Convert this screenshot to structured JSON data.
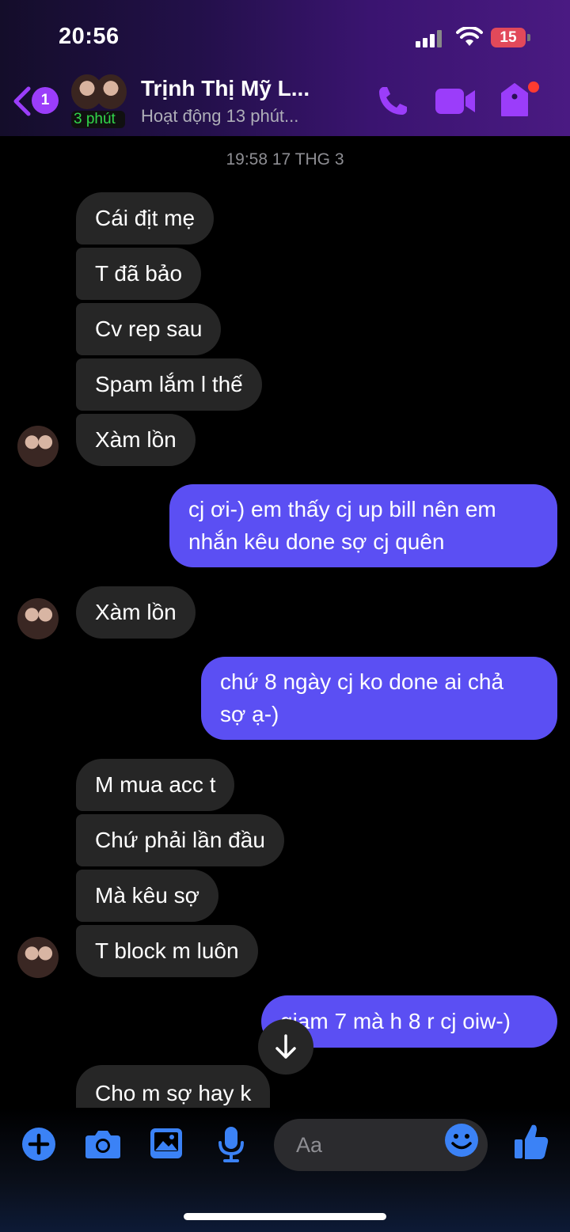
{
  "status_bar": {
    "time": "20:56",
    "battery": "15"
  },
  "header": {
    "back_badge": "1",
    "contact_name": "Trịnh Thị Mỹ L...",
    "active_ago": "3 phút",
    "status": "Hoạt động 13 phút..."
  },
  "timestamp": "19:58 17 THG 3",
  "messages": [
    {
      "from": "them",
      "text": "Cái địt mẹ"
    },
    {
      "from": "them",
      "text": "T đã bảo"
    },
    {
      "from": "them",
      "text": "Cv rep sau"
    },
    {
      "from": "them",
      "text": "Spam lắm l thế"
    },
    {
      "from": "them",
      "text": "Xàm lồn"
    },
    {
      "from": "me",
      "line1": "cj ơi-) em thấy cj up bill nên em",
      "line2": "nhắn kêu done sợ cj quên"
    },
    {
      "from": "them",
      "text": "Xàm lồn"
    },
    {
      "from": "me",
      "line1": "chứ 8 ngày cj ko done ai chả",
      "line2": "sợ ạ-)"
    },
    {
      "from": "them",
      "text": "M mua acc t"
    },
    {
      "from": "them",
      "text": "Chứ phải lần đầu"
    },
    {
      "from": "them",
      "text": "Mà kêu sợ"
    },
    {
      "from": "them",
      "text": "T block m luôn"
    },
    {
      "from": "me",
      "text": "giam 7 mà h 8 r cj oiw-)"
    },
    {
      "from": "them",
      "text": "Cho m sợ hay k"
    }
  ],
  "composer": {
    "placeholder": "Aa"
  },
  "colors": {
    "accent": "#3b82f6",
    "outgoing_bubble": "#5b4ff3",
    "incoming_bubble": "#262626",
    "header_accent": "#9b3dfa"
  }
}
